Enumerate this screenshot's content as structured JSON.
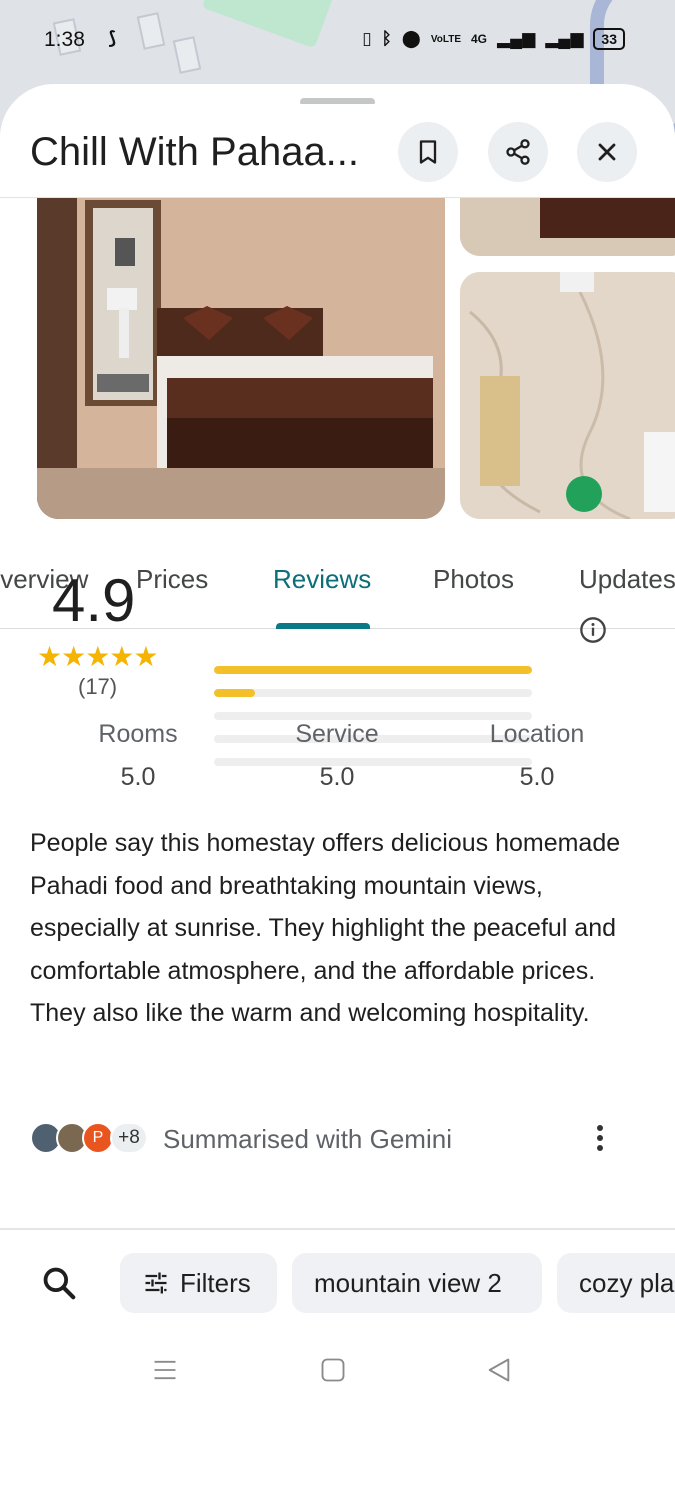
{
  "status_bar": {
    "time": "1:38",
    "network": "4G",
    "volte": "VoLTE",
    "battery": "33"
  },
  "place": {
    "title": "Chill With Pahaa..."
  },
  "header_actions": {
    "save_icon": "bookmark-icon",
    "share_icon": "share-icon",
    "close_icon": "close-icon"
  },
  "tabs": [
    {
      "label": "Overview"
    },
    {
      "label": "Prices"
    },
    {
      "label": "Reviews"
    },
    {
      "label": "Photos"
    },
    {
      "label": "Updates"
    }
  ],
  "active_tab": "Reviews",
  "rating": {
    "value": "4.9",
    "stars": "★★★★★",
    "count": "(17)",
    "distribution": [
      {
        "stars": 5,
        "fraction": 1.0
      },
      {
        "stars": 4,
        "fraction": 0.13
      },
      {
        "stars": 3,
        "fraction": 0.0
      },
      {
        "stars": 2,
        "fraction": 0.0
      },
      {
        "stars": 1,
        "fraction": 0.0
      }
    ]
  },
  "sub_ratings": [
    {
      "label": "Rooms",
      "value": "5.0"
    },
    {
      "label": "Service",
      "value": "5.0"
    },
    {
      "label": "Location",
      "value": "5.0"
    }
  ],
  "summary": {
    "text": "People say this homestay offers delicious homemade Pahadi food and breathtaking mountain views, especially at sunrise. They highlight the peaceful and comfortable atmosphere, and the affordable prices. They also like the warm and welcoming hospitality.",
    "avatar_initial": "P",
    "more_count": "+8",
    "attribution": "Summarised with Gemini"
  },
  "filters": {
    "filters_label": "Filters",
    "chips": [
      "mountain view 2",
      "cozy pla"
    ]
  },
  "colors": {
    "accent": "#0b7a86",
    "star": "#f4b400",
    "bar_fill": "#f4c029"
  }
}
